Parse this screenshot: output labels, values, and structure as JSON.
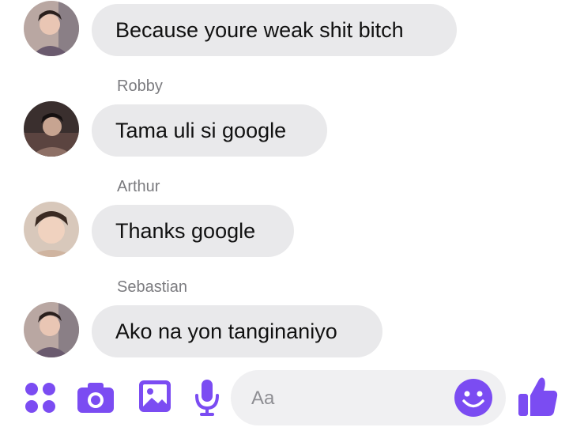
{
  "messages": [
    {
      "sender": "",
      "text": "Because youre weak shit bitch"
    },
    {
      "sender": "Robby",
      "text": "Tama uli si google"
    },
    {
      "sender": "Arthur",
      "text": "Thanks google"
    },
    {
      "sender": "Sebastian",
      "text": "Ako na yon tanginaniyo"
    }
  ],
  "composer": {
    "placeholder": "Aa",
    "icons": [
      "apps-icon",
      "camera-icon",
      "image-icon",
      "microphone-icon",
      "emoji-icon",
      "thumbs-up-icon"
    ]
  },
  "colors": {
    "accent": "#7b4cf2",
    "bubble": "#e9e9eb",
    "sender_name": "#7b7b7f"
  }
}
